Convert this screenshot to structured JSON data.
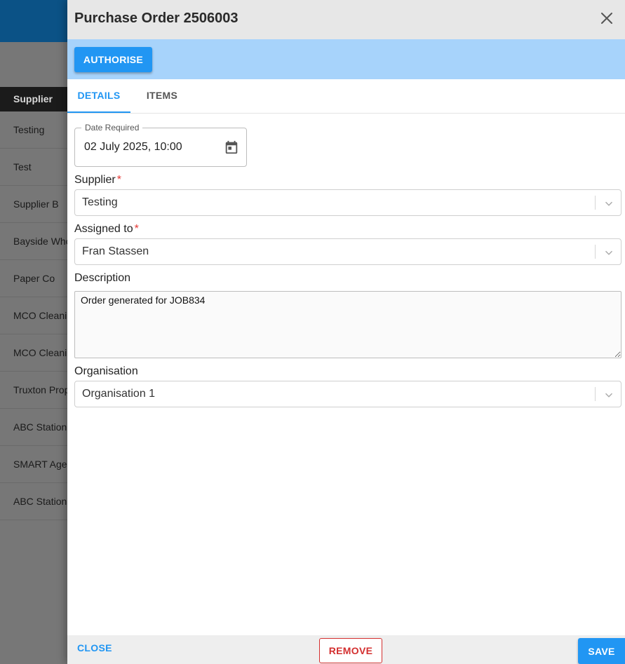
{
  "background": {
    "table_header": "Supplier",
    "rows": [
      "Testing",
      "Test",
      "Supplier B",
      "Bayside Who",
      "Paper Co",
      "MCO Cleanin",
      "MCO Cleanin",
      "Truxton Prop",
      "ABC Station",
      "SMART Agen",
      "ABC Station"
    ]
  },
  "drawer": {
    "title": "Purchase Order 2506003",
    "authorise_label": "AUTHORISE",
    "tabs": [
      "DETAILS",
      "ITEMS"
    ],
    "active_tab": "DETAILS"
  },
  "form": {
    "date_required": {
      "label": "Date Required",
      "value": "02 July 2025, 10:00"
    },
    "supplier": {
      "label": "Supplier",
      "required_mark": "*",
      "value": "Testing"
    },
    "assigned_to": {
      "label": "Assigned to",
      "required_mark": "*",
      "value": "Fran Stassen"
    },
    "description": {
      "label": "Description",
      "value": "Order generated for JOB834"
    },
    "organisation": {
      "label": "Organisation",
      "value": "Organisation 1"
    }
  },
  "footer": {
    "close_label": "CLOSE",
    "remove_label": "REMOVE",
    "save_label": "SAVE"
  },
  "colors": {
    "primary": "#2196f3",
    "danger": "#d32f2f",
    "action_bar": "#a7d3fb",
    "required": "#e53935"
  },
  "icons": [
    "close-icon",
    "calendar-icon",
    "chevron-down-icon"
  ]
}
